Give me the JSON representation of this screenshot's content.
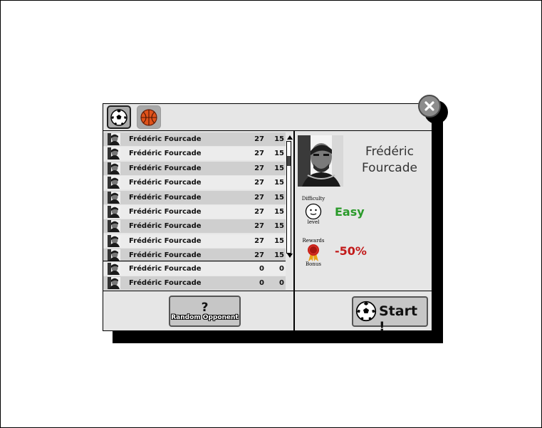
{
  "dialog": {
    "tabs": [
      {
        "icon": "soccer-ball-icon",
        "active": true
      },
      {
        "icon": "basketball-icon",
        "active": false
      }
    ]
  },
  "players": [
    {
      "name": "Frédéric Fourcade",
      "c1": "27",
      "c2": "15"
    },
    {
      "name": "Frédéric Fourcade",
      "c1": "27",
      "c2": "15"
    },
    {
      "name": "Frédéric Fourcade",
      "c1": "27",
      "c2": "15"
    },
    {
      "name": "Frédéric Fourcade",
      "c1": "27",
      "c2": "15"
    },
    {
      "name": "Frédéric Fourcade",
      "c1": "27",
      "c2": "15"
    },
    {
      "name": "Frédéric Fourcade",
      "c1": "27",
      "c2": "15"
    },
    {
      "name": "Frédéric Fourcade",
      "c1": "27",
      "c2": "15"
    },
    {
      "name": "Frédéric Fourcade",
      "c1": "27",
      "c2": "15"
    },
    {
      "name": "Frédéric Fourcade",
      "c1": "27",
      "c2": "15"
    }
  ],
  "extra_players": [
    {
      "name": "Frédéric Fourcade",
      "c1": "0",
      "c2": "0"
    },
    {
      "name": "Frédéric Fourcade",
      "c1": "0",
      "c2": "0"
    }
  ],
  "random_button": {
    "symbol": "?",
    "label": "Random Opponent"
  },
  "opponent": {
    "name_line1": "Frédéric",
    "name_line2": "Fourcade",
    "difficulty_label": "Difficulty",
    "difficulty_sub": "level",
    "difficulty_value": "Easy",
    "rewards_label": "Rewards",
    "rewards_sub": "Bonus",
    "rewards_value": "-50%"
  },
  "start_button": {
    "label": "Start !"
  },
  "colors": {
    "easy": "#2a9a2a",
    "bonus": "#c21a1a",
    "row_dark": "#cfcfcf",
    "row_light": "#ececec"
  }
}
